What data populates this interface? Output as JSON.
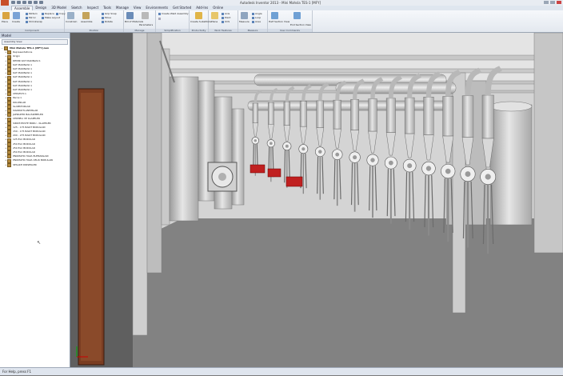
{
  "window": {
    "title": "Autodesk Inventor 2013 - Mini Mahsla TES-1 [MFY]"
  },
  "tabs": [
    "Assemble",
    "Design",
    "3D Model",
    "Sketch",
    "Inspect",
    "Tools",
    "Manage",
    "View",
    "Environments",
    "Get Started",
    "Add-Ins",
    "Online"
  ],
  "ribbon": {
    "place": "Place",
    "create": "Create",
    "pattern": "Pattern",
    "replace": "Replace",
    "copy": "Copy",
    "mirror": "Mirror",
    "make_layout": "Make Layout",
    "shrinkwrap": "Shrinkwrap",
    "constrain": "Constrain",
    "assemble": "Assemble",
    "drag_snap": "Grip Snap",
    "move": "Move",
    "rotate": "Rotate",
    "bill_of_materials": "Bill of Materials",
    "parameters": "Parameters",
    "create_weld_assembly": "Create Weld Assembly",
    "create_substitute": "Create Substitute",
    "plane": "Plane",
    "axis": "Axis",
    "point": "Point",
    "ucs": "UCS",
    "measure": "Measure",
    "angle": "Angle",
    "loop": "Loop",
    "area": "Area",
    "half_section": "Half Section View",
    "end_section": "End Section View",
    "panel_component": "Component",
    "panel_position": "Position",
    "panel_manage": "Manage",
    "panel_simplification": "Simplification",
    "panel_productivity": "Productivity",
    "panel_work_features": "Work Features",
    "panel_measure": "Measure",
    "panel_user_commands": "User Commands"
  },
  "browser": {
    "header": "Model",
    "selector": "Assembly View",
    "items": [
      {
        "label": "Mini Mahsla TES-1 [MFY].iam",
        "level": 0,
        "expander": "-",
        "bold": true
      },
      {
        "label": "Representations",
        "level": 1,
        "expander": "+"
      },
      {
        "label": "Origin",
        "level": 1,
        "expander": "+"
      },
      {
        "label": "DEMIR KAT MAKINASI:1",
        "level": 1,
        "expander": "+"
      },
      {
        "label": "KAT MAKINASI:1",
        "level": 1,
        "expander": "+"
      },
      {
        "label": "KAT MAKINASI:1",
        "level": 1,
        "expander": "+"
      },
      {
        "label": "KAT MAKINASI:1",
        "level": 1,
        "expander": "+"
      },
      {
        "label": "KAT MAKINASI:1",
        "level": 1,
        "expander": "+"
      },
      {
        "label": "KAT MAKINASI:1",
        "level": 1,
        "expander": "+"
      },
      {
        "label": "KAT MAKINASI:1",
        "level": 1,
        "expander": "+"
      },
      {
        "label": "KAT MAKINASI:1",
        "level": 1,
        "expander": "+"
      },
      {
        "label": "CEPLESTI:1",
        "level": 1,
        "expander": "+"
      },
      {
        "label": "Parca:1",
        "level": 1,
        "expander": "+"
      },
      {
        "label": "KOLONLAR",
        "level": 1,
        "expander": "+"
      },
      {
        "label": "SLABSTORLAR",
        "level": 1,
        "expander": "+"
      },
      {
        "label": "SIGIRKOTLANMISLAR",
        "level": 1,
        "expander": "+"
      },
      {
        "label": "JAPRAKTIR BALISIZMELER",
        "level": 1,
        "expander": "+"
      },
      {
        "label": "CEKMELI VE KLAPELER",
        "level": 1,
        "expander": "+"
      },
      {
        "label": "SIRKIT-EKSTE BORU - KLAPELER",
        "level": 1,
        "expander": "+"
      },
      {
        "label": "125 - 175 BAKIT BORULARI",
        "level": 1,
        "expander": "+"
      },
      {
        "label": "150 - 175 BAKIT BORULARI",
        "level": 1,
        "expander": "+"
      },
      {
        "label": "200 - 275 BAKIT BORULARI",
        "level": 1,
        "expander": "+"
      },
      {
        "label": "125 ELC BORULAR",
        "level": 1,
        "expander": "+"
      },
      {
        "label": "250 ELC BORULAR",
        "level": 1,
        "expander": "+"
      },
      {
        "label": "250 ELC BORULAR",
        "level": 1,
        "expander": "+"
      },
      {
        "label": "250 ELC BORULAR",
        "level": 1,
        "expander": "+"
      },
      {
        "label": "PNOMATIK HAVA ELEMANLARI",
        "level": 1,
        "expander": "+"
      },
      {
        "label": "PNOMATIK HAVA CELIK BORULARI",
        "level": 1,
        "expander": "+"
      },
      {
        "label": "SESAKH DIRSEKLER",
        "level": 1,
        "expander": "+"
      }
    ]
  },
  "status": {
    "text": "For Help, press F1"
  }
}
